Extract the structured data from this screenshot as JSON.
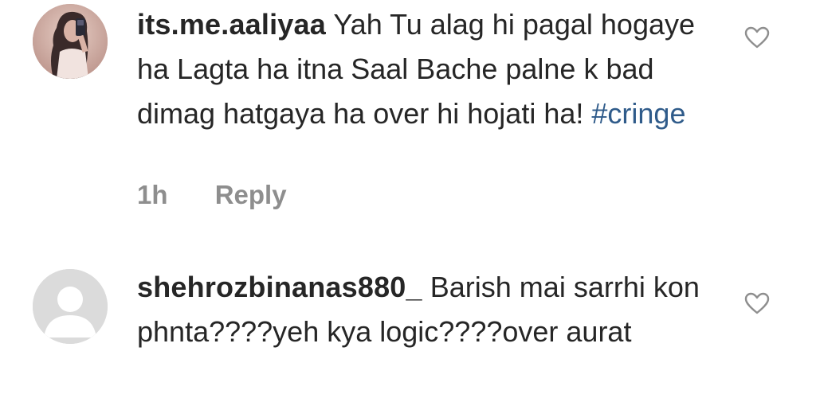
{
  "comments": [
    {
      "username": "its.me.aaliyaa",
      "text": "Yah Tu alag hi pagal hogaye ha Lagta ha itna Saal Bache palne k bad dimag hatgaya ha over hi hojati ha!",
      "hashtag": "#cringe",
      "time": "1h",
      "reply_label": "Reply",
      "like_icon": "heart-outline-icon",
      "avatar": "photo-avatar"
    },
    {
      "username": "shehrozbinanas880_",
      "text": "Barish mai sarrhi kon phnta????yeh kya logic????over aurat",
      "like_icon": "heart-outline-icon",
      "avatar": "default-avatar"
    }
  ],
  "colors": {
    "text": "#262626",
    "hashtag": "#2f5b8a",
    "meta": "#8e8e8e",
    "default_avatar_bg": "#dbdbdb"
  }
}
